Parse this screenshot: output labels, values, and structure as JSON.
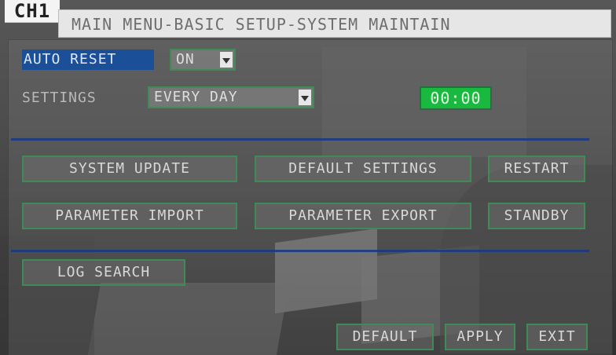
{
  "logo_text": "CH1",
  "title": "MAIN MENU-BASIC SETUP-SYSTEM MAINTAIN",
  "auto_reset": {
    "label": "AUTO RESET",
    "value": "ON"
  },
  "settings": {
    "label": "SETTINGS",
    "value": "EVERY DAY",
    "time": "00:00"
  },
  "actions_row1": {
    "system_update": "SYSTEM UPDATE",
    "default_settings": "DEFAULT SETTINGS",
    "restart": "RESTART"
  },
  "actions_row2": {
    "parameter_import": "PARAMETER IMPORT",
    "parameter_export": "PARAMETER EXPORT",
    "standby": "STANDBY"
  },
  "log": {
    "search": "LOG SEARCH"
  },
  "footer": {
    "default": "DEFAULT",
    "apply": "APPLY",
    "exit": "EXIT"
  },
  "colors": {
    "selection_blue": "#1B4F98",
    "time_green": "#19B83F",
    "frame_green": "#3E8B57",
    "divider_blue": "#1A3A82",
    "title_bg": "#E6E6E6"
  },
  "icons": {
    "dropdown": "caret-down-icon"
  }
}
